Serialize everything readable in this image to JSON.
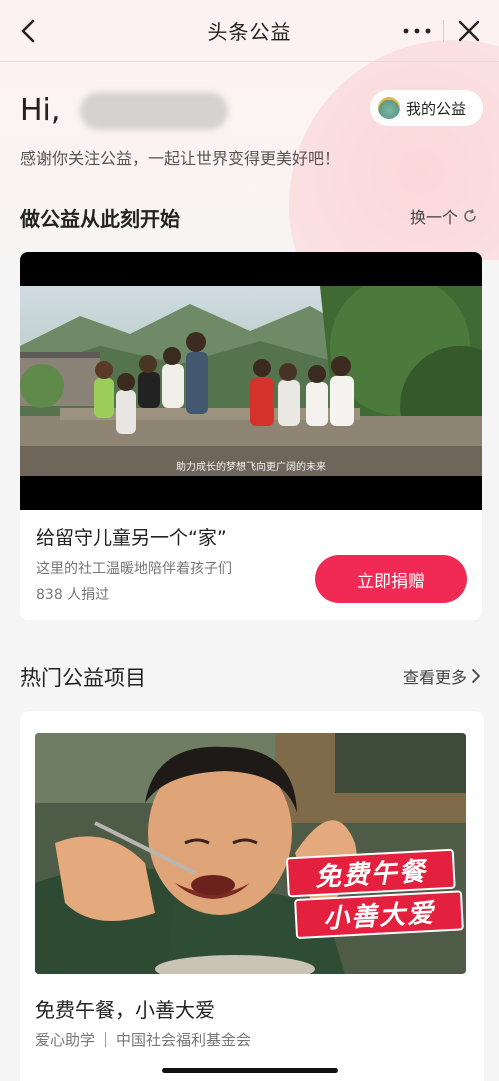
{
  "nav": {
    "title": "头条公益",
    "back_icon": "back-chevron-icon",
    "more_icon": "more-dots-icon",
    "close_icon": "close-icon"
  },
  "header": {
    "greeting": "Hi,",
    "my_charity_label": "我的公益",
    "subtitle": "感谢你关注公益，一起让世界变得更美好吧！"
  },
  "featured": {
    "section_title": "做公益从此刻开始",
    "refresh_label": "换一个",
    "video_caption": "助力成长的梦想飞向更广阔的未来",
    "title": "给留守儿童另一个“家”",
    "description": "这里的社工温暖地陪伴着孩子们",
    "donor_count": "838 人捐过",
    "donate_label": "立即捐赠"
  },
  "hot": {
    "section_title": "热门公益项目",
    "more_label": "查看更多",
    "items": [
      {
        "badge_line1": "免费午餐",
        "badge_line2": "小善大爱",
        "title": "免费午餐，小善大爱",
        "category": "爱心助学",
        "organization": "中国社会福利基金会"
      }
    ]
  },
  "colors": {
    "accent": "#f02a55",
    "badge_red": "#e3213f",
    "background": "#f5f5f5"
  }
}
